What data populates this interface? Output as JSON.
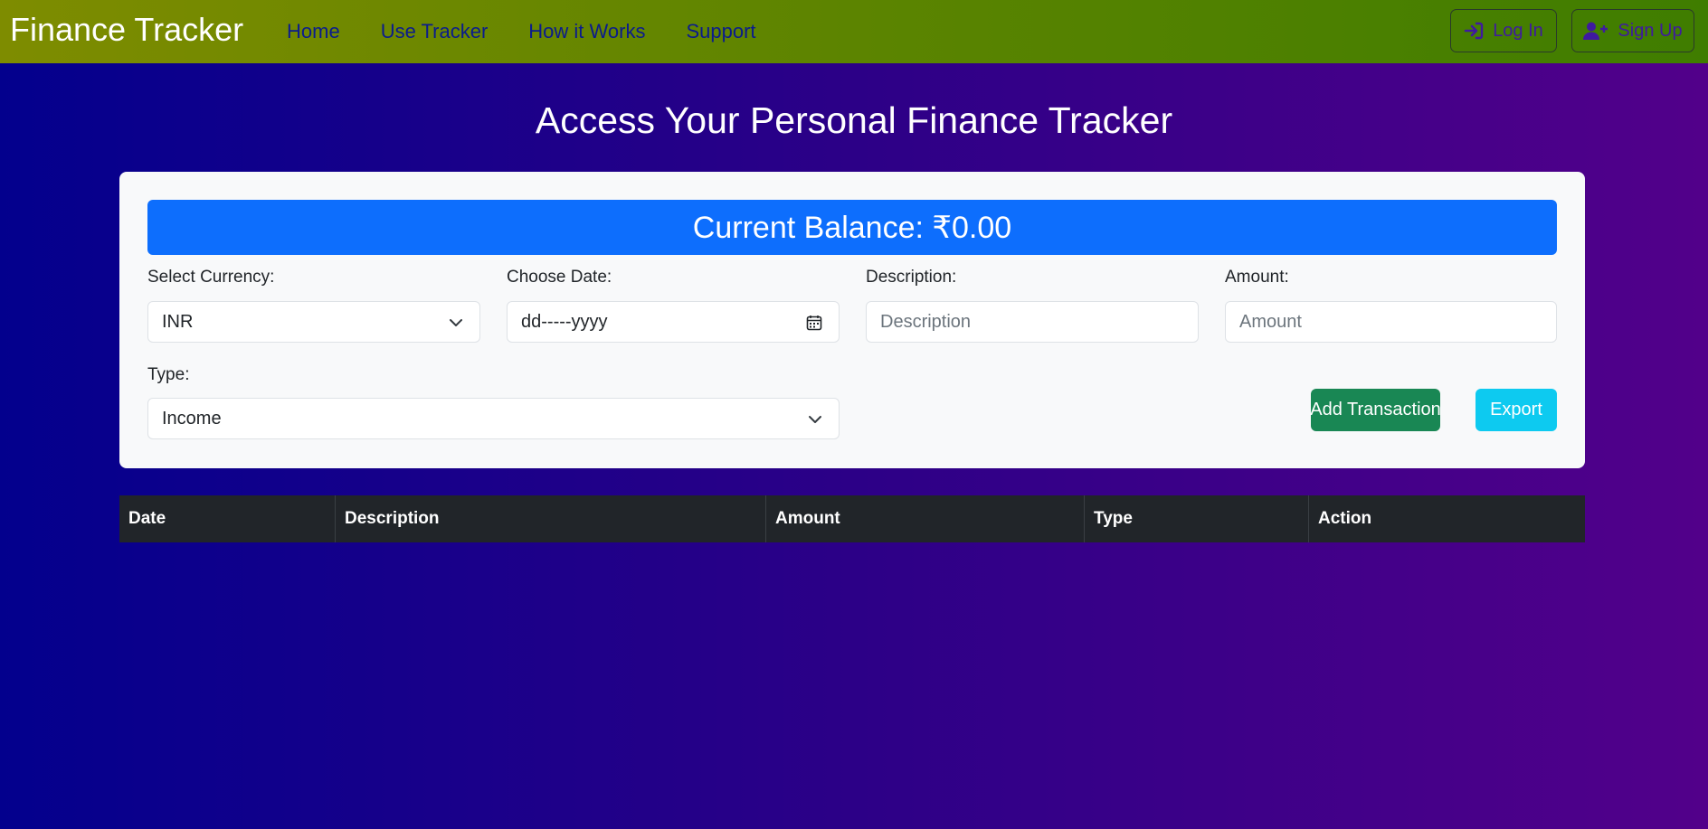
{
  "navbar": {
    "brand": "Finance Tracker",
    "links": [
      "Home",
      "Use Tracker",
      "How it Works",
      "Support"
    ],
    "login_label": "Log In",
    "signup_label": "Sign Up"
  },
  "page_title": "Access Your Personal Finance Tracker",
  "form": {
    "balance_text": "Current Balance: ₹0.00",
    "currency_label": "Select Currency:",
    "currency_value": "INR",
    "date_label": "Choose Date:",
    "date_value": "dd-----yyyy",
    "description_label": "Description:",
    "description_placeholder": "Description",
    "amount_label": "Amount:",
    "amount_placeholder": "Amount",
    "type_label": "Type:",
    "type_value": "Income",
    "add_button": "Add Transaction",
    "export_button": "Export"
  },
  "table": {
    "headers": [
      "Date",
      "Description",
      "Amount",
      "Type",
      "Action"
    ],
    "rows": []
  },
  "colors": {
    "balance_bg": "#0d6efd",
    "add_button_bg": "#198754",
    "export_button_bg": "#0dcaf0",
    "table_head_bg": "#212529"
  }
}
